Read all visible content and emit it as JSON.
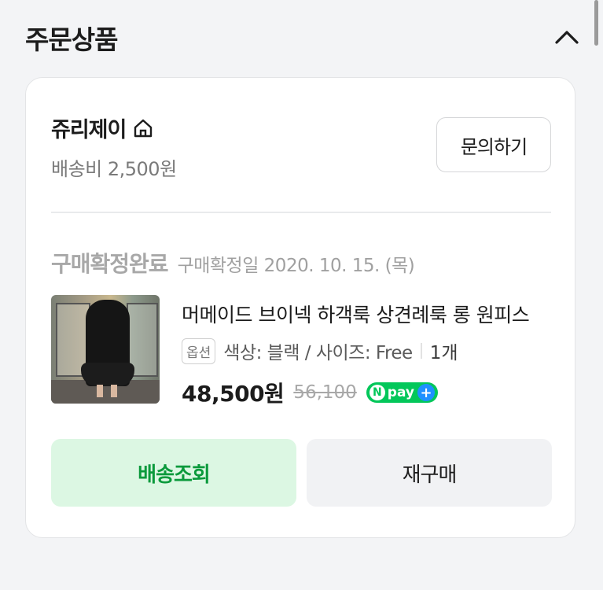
{
  "section": {
    "title": "주문상품"
  },
  "seller": {
    "name": "쥬리제이",
    "shipping_fee": "배송비 2,500원",
    "inquiry_label": "문의하기"
  },
  "order": {
    "status": "구매확정완료",
    "confirm_date": "구매확정일 2020. 10. 15. (목)"
  },
  "product": {
    "name": "머메이드 브이넥 하객룩 상견례룩 롱 원피스",
    "option_badge": "옵션",
    "option_text": "색상: 블랙 / 사이즈: Free",
    "quantity": "1개",
    "price": "48,500원",
    "original_price": "56,100",
    "npay_label": "pay",
    "npay_n": "N"
  },
  "actions": {
    "track_label": "배송조회",
    "rebuy_label": "재구매"
  },
  "colors": {
    "accent_green": "#0b9a3c",
    "track_bg": "#dcf7e3",
    "npay_green": "#03c75a",
    "npay_blue": "#1e90ff"
  },
  "icons": {
    "collapse": "chevron-up-icon",
    "store": "home-icon",
    "npay_plus": "plus-icon"
  }
}
